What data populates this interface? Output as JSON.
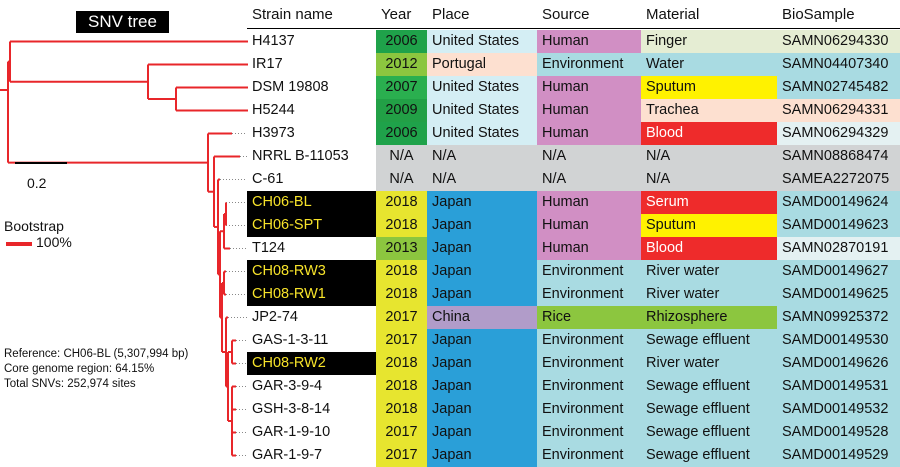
{
  "tree": {
    "title": "SNV tree",
    "scale_label": "0.2",
    "bootstrap_label": "Bootstrap",
    "bootstrap_value": "100%",
    "branch_color": "#e8262a",
    "info": [
      "Reference: CH06-BL (5,307,994 bp)",
      "Core genome region: 64.15%",
      "Total SNVs: 252,974 sites"
    ]
  },
  "table": {
    "headers": {
      "strain": "Strain name",
      "year": "Year",
      "place": "Place",
      "source": "Source",
      "material": "Material",
      "biosample": "BioSample"
    },
    "colors": {
      "year": {
        "2006": "#1fa24a",
        "2007": "#2aaf4f",
        "2009": "#22a046",
        "2012": "#8cc63f",
        "2013": "#8cc63f",
        "2017": "#e7e52f",
        "2018": "#e7e52f",
        "N/A": "#d1d3d4"
      },
      "place": {
        "United States": "#d4eef4",
        "Portugal": "#fde0d0",
        "Japan": "#2a9fd8",
        "China": "#b19cc9",
        "N/A": "#d1d3d4"
      },
      "source": {
        "Human": "#d18fc4",
        "Environment": "#a9dbe2",
        "Rice": "#8cc63f",
        "N/A": "#d1d3d4"
      },
      "material": {
        "Finger": "#e5edd3",
        "Water": "#a9dbe2",
        "Sputum": "#fff200",
        "Trachea": "#fde0d0",
        "Blood": "#ee2b2b",
        "Serum": "#ee2b2b",
        "River water": "#a9dbe2",
        "Rhizosphere": "#8cc63f",
        "Sewage effluent": "#a9dbe2",
        "N/A": "#d1d3d4"
      },
      "biosample": {
        "Finger": "#e5edd3",
        "Water": "#a9dbe2",
        "Sputum": "#a9dbe2",
        "Trachea": "#fde0d0",
        "Blood": "#e4f1f2",
        "Serum": "#a9dbe2",
        "River water": "#a9dbe2",
        "Rhizosphere": "#a9dbe2",
        "Sewage effluent": "#a9dbe2",
        "N/A": "#d1d3d4"
      }
    },
    "rows": [
      {
        "strain": "H4137",
        "year": "2006",
        "place": "United States",
        "source": "Human",
        "material": "Finger",
        "biosample": "SAMN06294330",
        "highlight": false
      },
      {
        "strain": "IR17",
        "year": "2012",
        "place": "Portugal",
        "source": "Environment",
        "material": "Water",
        "biosample": "SAMN04407340",
        "highlight": false
      },
      {
        "strain": "DSM 19808",
        "year": "2007",
        "place": "United States",
        "source": "Human",
        "material": "Sputum",
        "biosample": "SAMN02745482",
        "highlight": false
      },
      {
        "strain": "H5244",
        "year": "2009",
        "place": "United States",
        "source": "Human",
        "material": "Trachea",
        "biosample": "SAMN06294331",
        "highlight": false
      },
      {
        "strain": "H3973",
        "year": "2006",
        "place": "United States",
        "source": "Human",
        "material": "Blood",
        "biosample": "SAMN06294329",
        "highlight": false
      },
      {
        "strain": "NRRL B-11053",
        "year": "N/A",
        "place": "N/A",
        "source": "N/A",
        "material": "N/A",
        "biosample": "SAMN08868474",
        "highlight": false
      },
      {
        "strain": "C-61",
        "year": "N/A",
        "place": "N/A",
        "source": "N/A",
        "material": "N/A",
        "biosample": "SAMEA2272075",
        "highlight": false
      },
      {
        "strain": "CH06-BL",
        "year": "2018",
        "place": "Japan",
        "source": "Human",
        "material": "Serum",
        "biosample": "SAMD00149624",
        "highlight": true
      },
      {
        "strain": "CH06-SPT",
        "year": "2018",
        "place": "Japan",
        "source": "Human",
        "material": "Sputum",
        "biosample": "SAMD00149623",
        "highlight": true
      },
      {
        "strain": "T124",
        "year": "2013",
        "place": "Japan",
        "source": "Human",
        "material": "Blood",
        "biosample": "SAMN02870191",
        "highlight": false
      },
      {
        "strain": "CH08-RW3",
        "year": "2018",
        "place": "Japan",
        "source": "Environment",
        "material": "River water",
        "biosample": "SAMD00149627",
        "highlight": true
      },
      {
        "strain": "CH08-RW1",
        "year": "2018",
        "place": "Japan",
        "source": "Environment",
        "material": "River water",
        "biosample": "SAMD00149625",
        "highlight": true
      },
      {
        "strain": "JP2-74",
        "year": "2017",
        "place": "China",
        "source": "Rice",
        "material": "Rhizosphere",
        "biosample": "SAMN09925372",
        "highlight": false
      },
      {
        "strain": "GAS-1-3-11",
        "year": "2017",
        "place": "Japan",
        "source": "Environment",
        "material": "Sewage effluent",
        "biosample": "SAMD00149530",
        "highlight": false
      },
      {
        "strain": "CH08-RW2",
        "year": "2018",
        "place": "Japan",
        "source": "Environment",
        "material": "River water",
        "biosample": "SAMD00149626",
        "highlight": true
      },
      {
        "strain": "GAR-3-9-4",
        "year": "2018",
        "place": "Japan",
        "source": "Environment",
        "material": "Sewage effluent",
        "biosample": "SAMD00149531",
        "highlight": false
      },
      {
        "strain": "GSH-3-8-14",
        "year": "2018",
        "place": "Japan",
        "source": "Environment",
        "material": "Sewage effluent",
        "biosample": "SAMD00149532",
        "highlight": false
      },
      {
        "strain": "GAR-1-9-10",
        "year": "2017",
        "place": "Japan",
        "source": "Environment",
        "material": "Sewage effluent",
        "biosample": "SAMD00149528",
        "highlight": false
      },
      {
        "strain": "GAR-1-9-7",
        "year": "2017",
        "place": "Japan",
        "source": "Environment",
        "material": "Sewage effluent",
        "biosample": "SAMD00149529",
        "highlight": false
      }
    ]
  }
}
